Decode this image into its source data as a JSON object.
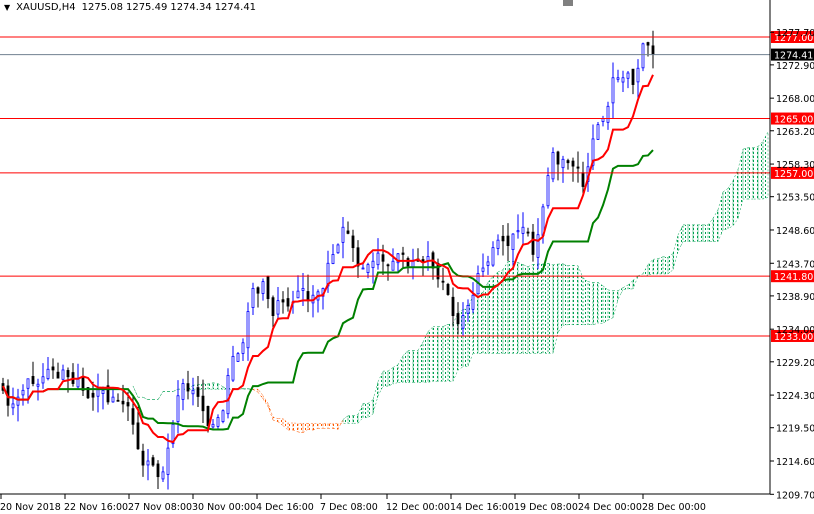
{
  "header": {
    "symbol": "XAUUSD,H4",
    "open": "1275.08",
    "high": "1275.49",
    "low": "1274.34",
    "close": "1274.41"
  },
  "colors": {
    "bull": "#0000ff",
    "bear": "#000000",
    "tenkan": "#ff0000",
    "kijun": "#008000",
    "cloud_up": "#00a050",
    "cloud_down": "#ff5a00",
    "level": "#ff0000",
    "current": "#000000"
  },
  "chart_data": {
    "type": "candlestick",
    "title": "XAUUSD,H4",
    "ylim": [
      1209.7,
      1281.5
    ],
    "y_ticks": [
      "1277.70",
      "1272.90",
      "1268.00",
      "1263.20",
      "1258.30",
      "1253.50",
      "1248.60",
      "1243.70",
      "1238.90",
      "1234.00",
      "1229.20",
      "1224.30",
      "1219.50",
      "1214.60",
      "1209.70"
    ],
    "x_ticks": [
      "20 Nov 2018",
      "22 Nov 16:00",
      "27 Nov 08:00",
      "30 Nov 00:00",
      "4 Dec 16:00",
      "7 Dec 08:00",
      "12 Dec 00:00",
      "14 Dec 16:00",
      "19 Dec 08:00",
      "24 Dec 00:00",
      "28 Dec 00:00"
    ],
    "closes_sampled": [
      1225,
      1223,
      1225,
      1226,
      1227,
      1228,
      1228,
      1226,
      1225,
      1224,
      1225,
      1224,
      1223,
      1220,
      1214,
      1214,
      1213,
      1220,
      1226,
      1225,
      1222,
      1220,
      1222,
      1230,
      1232,
      1240,
      1241,
      1236,
      1238,
      1238,
      1240,
      1239,
      1240,
      1245,
      1249,
      1246,
      1243,
      1244,
      1244,
      1244,
      1245,
      1244,
      1244,
      1243,
      1241,
      1236,
      1236,
      1239,
      1243,
      1246,
      1247,
      1248,
      1249,
      1245,
      1252,
      1260,
      1259,
      1258,
      1255,
      1262,
      1265,
      1271,
      1271,
      1270,
      1276,
      1274.41
    ],
    "levels": [
      {
        "price": 1277.0,
        "label": "1277.00",
        "kind": "resistance"
      },
      {
        "price": 1274.41,
        "label": "1274.41",
        "kind": "current"
      },
      {
        "price": 1265.0,
        "label": "1265.00",
        "kind": "resistance"
      },
      {
        "price": 1257.0,
        "label": "1257.00",
        "kind": "support"
      },
      {
        "price": 1241.8,
        "label": "1241.80",
        "kind": "support"
      },
      {
        "price": 1233.0,
        "label": "1233.00",
        "kind": "support"
      }
    ],
    "indicators": [
      "Ichimoku Tenkan-sen",
      "Ichimoku Kijun-sen",
      "Ichimoku Cloud"
    ]
  }
}
